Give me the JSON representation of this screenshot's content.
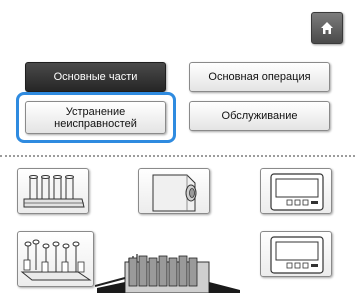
{
  "toolbar": {
    "home_icon": "home-icon"
  },
  "categories": {
    "basic_parts": "Основные части",
    "basic_operation": "Основная операция",
    "troubleshooting": "Устранение\nнеисправностей",
    "maintenance": "Обслуживание"
  },
  "colors": {
    "highlight": "#2f8be0",
    "selected_button": "#333333"
  },
  "illustrations": [
    "thread-spools-icon",
    "handwheel-icon",
    "lcd-panel-icon",
    "spool-stand-icon",
    "lcd-panel-icon"
  ]
}
